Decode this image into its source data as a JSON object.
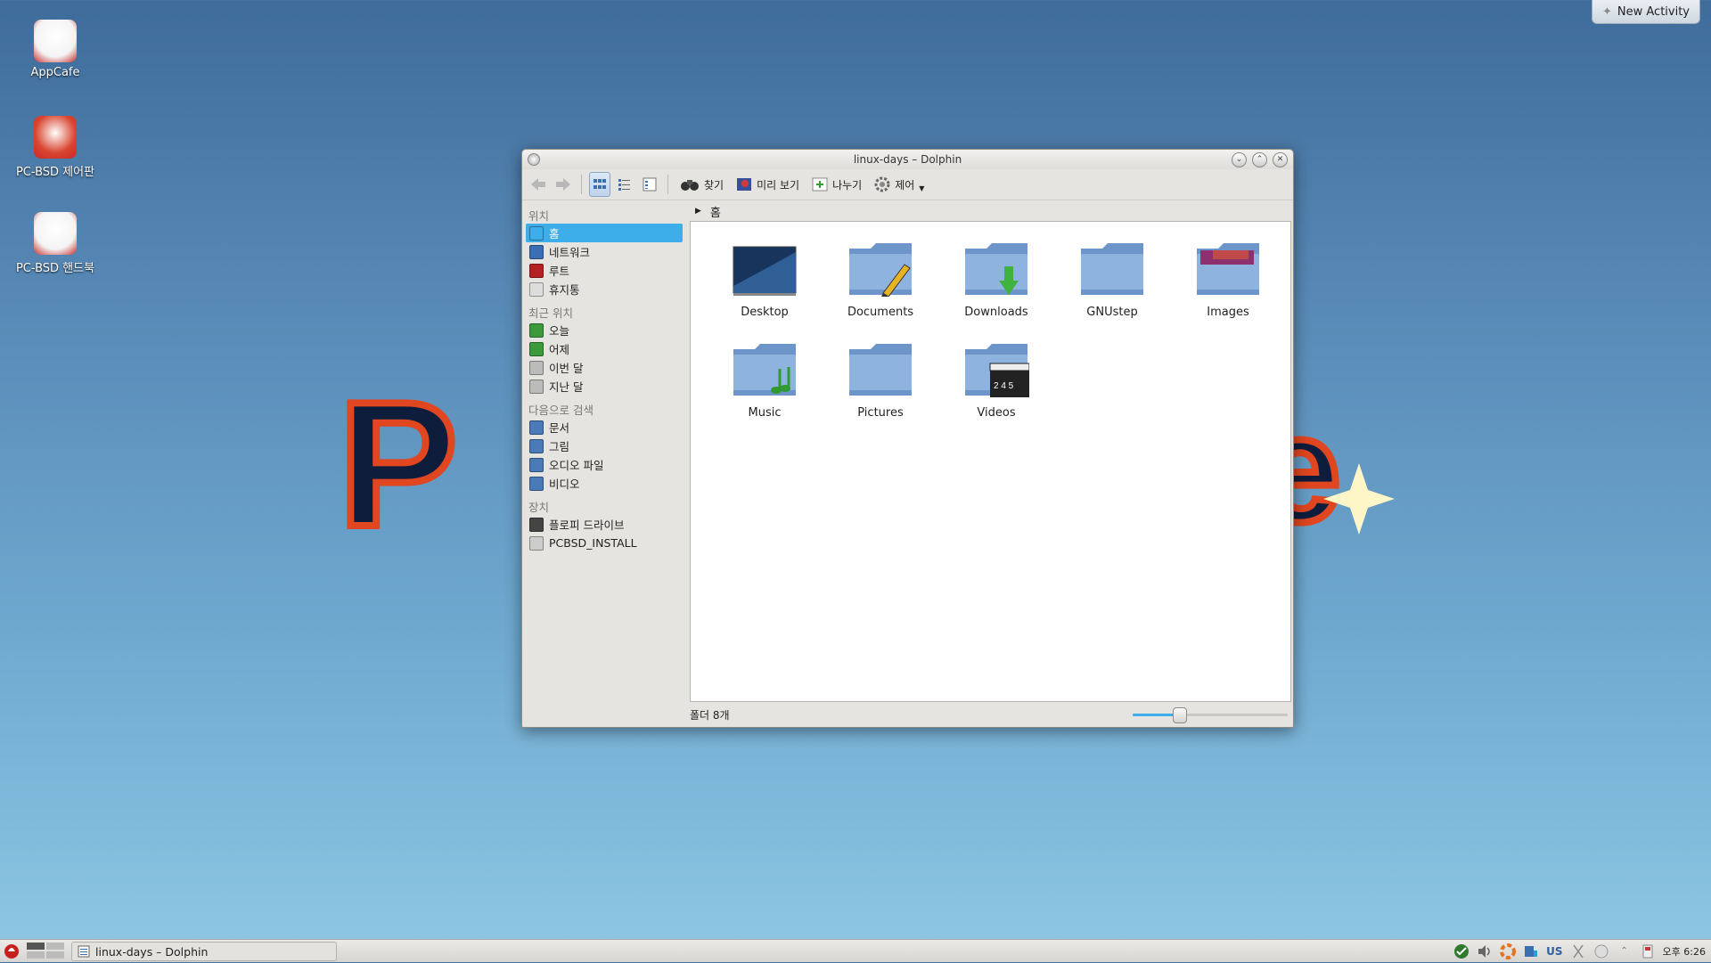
{
  "desktop": {
    "icons": [
      {
        "label": "AppCafe",
        "icon": "appcafe-mug-icon"
      },
      {
        "label": "PC-BSD 제어판",
        "icon": "control-panel-tools-icon"
      },
      {
        "label": "PC-BSD 핸드북",
        "icon": "handbook-icon"
      }
    ],
    "new_activity_label": "New Activity"
  },
  "window": {
    "title": "linux-days – Dolphin",
    "toolbar": {
      "search_label": "찾기",
      "preview_label": "미리 보기",
      "split_label": "나누기",
      "control_label": "제어"
    },
    "places": {
      "groups": [
        {
          "title": "위치",
          "items": [
            {
              "label": "홈",
              "icon": "home-icon",
              "color": "#3daee9"
            },
            {
              "label": "네트워크",
              "icon": "network-globe-icon",
              "color": "#3b6fb5"
            },
            {
              "label": "루트",
              "icon": "root-folder-icon",
              "color": "#b22222"
            },
            {
              "label": "휴지통",
              "icon": "trash-icon",
              "color": "#dddddd"
            }
          ]
        },
        {
          "title": "최근 위치",
          "items": [
            {
              "label": "오늘",
              "icon": "calendar-today-icon",
              "color": "#3c9a3c"
            },
            {
              "label": "어제",
              "icon": "calendar-yesterday-icon",
              "color": "#3c9a3c"
            },
            {
              "label": "이번 달",
              "icon": "calendar-this-month-icon",
              "color": "#bbbbbb"
            },
            {
              "label": "지난 달",
              "icon": "calendar-last-month-icon",
              "color": "#bbbbbb"
            }
          ]
        },
        {
          "title": "다음으로 검색",
          "items": [
            {
              "label": "문서",
              "icon": "document-icon",
              "color": "#4a7ab8"
            },
            {
              "label": "그림",
              "icon": "image-icon",
              "color": "#4a7ab8"
            },
            {
              "label": "오디오 파일",
              "icon": "audio-icon",
              "color": "#4a7ab8"
            },
            {
              "label": "비디오",
              "icon": "video-icon",
              "color": "#4a7ab8"
            }
          ]
        },
        {
          "title": "장치",
          "items": [
            {
              "label": "플로피 드라이브",
              "icon": "floppy-icon",
              "color": "#444444"
            },
            {
              "label": "PCBSD_INSTALL",
              "icon": "optical-disc-icon",
              "color": "#cccccc"
            }
          ]
        }
      ],
      "selected": "홈"
    },
    "breadcrumb": {
      "current": "홈"
    },
    "files": [
      {
        "name": "Desktop",
        "icon": "desktop-folder-icon"
      },
      {
        "name": "Documents",
        "icon": "documents-folder-icon"
      },
      {
        "name": "Downloads",
        "icon": "downloads-folder-icon"
      },
      {
        "name": "GNUstep",
        "icon": "folder-icon"
      },
      {
        "name": "Images",
        "icon": "images-folder-icon"
      },
      {
        "name": "Music",
        "icon": "music-folder-icon"
      },
      {
        "name": "Pictures",
        "icon": "pictures-folder-icon"
      },
      {
        "name": "Videos",
        "icon": "videos-folder-icon"
      }
    ],
    "status": {
      "text": "폴더 8개",
      "zoom_fraction": 0.3
    }
  },
  "taskbar": {
    "task_label": "linux-days – Dolphin",
    "keyboard_layout": "US",
    "clock": "오후 6:26"
  },
  "colors": {
    "accent": "#3daee9",
    "folder_body": "#8fb3df",
    "folder_dark": "#6d95c9"
  }
}
